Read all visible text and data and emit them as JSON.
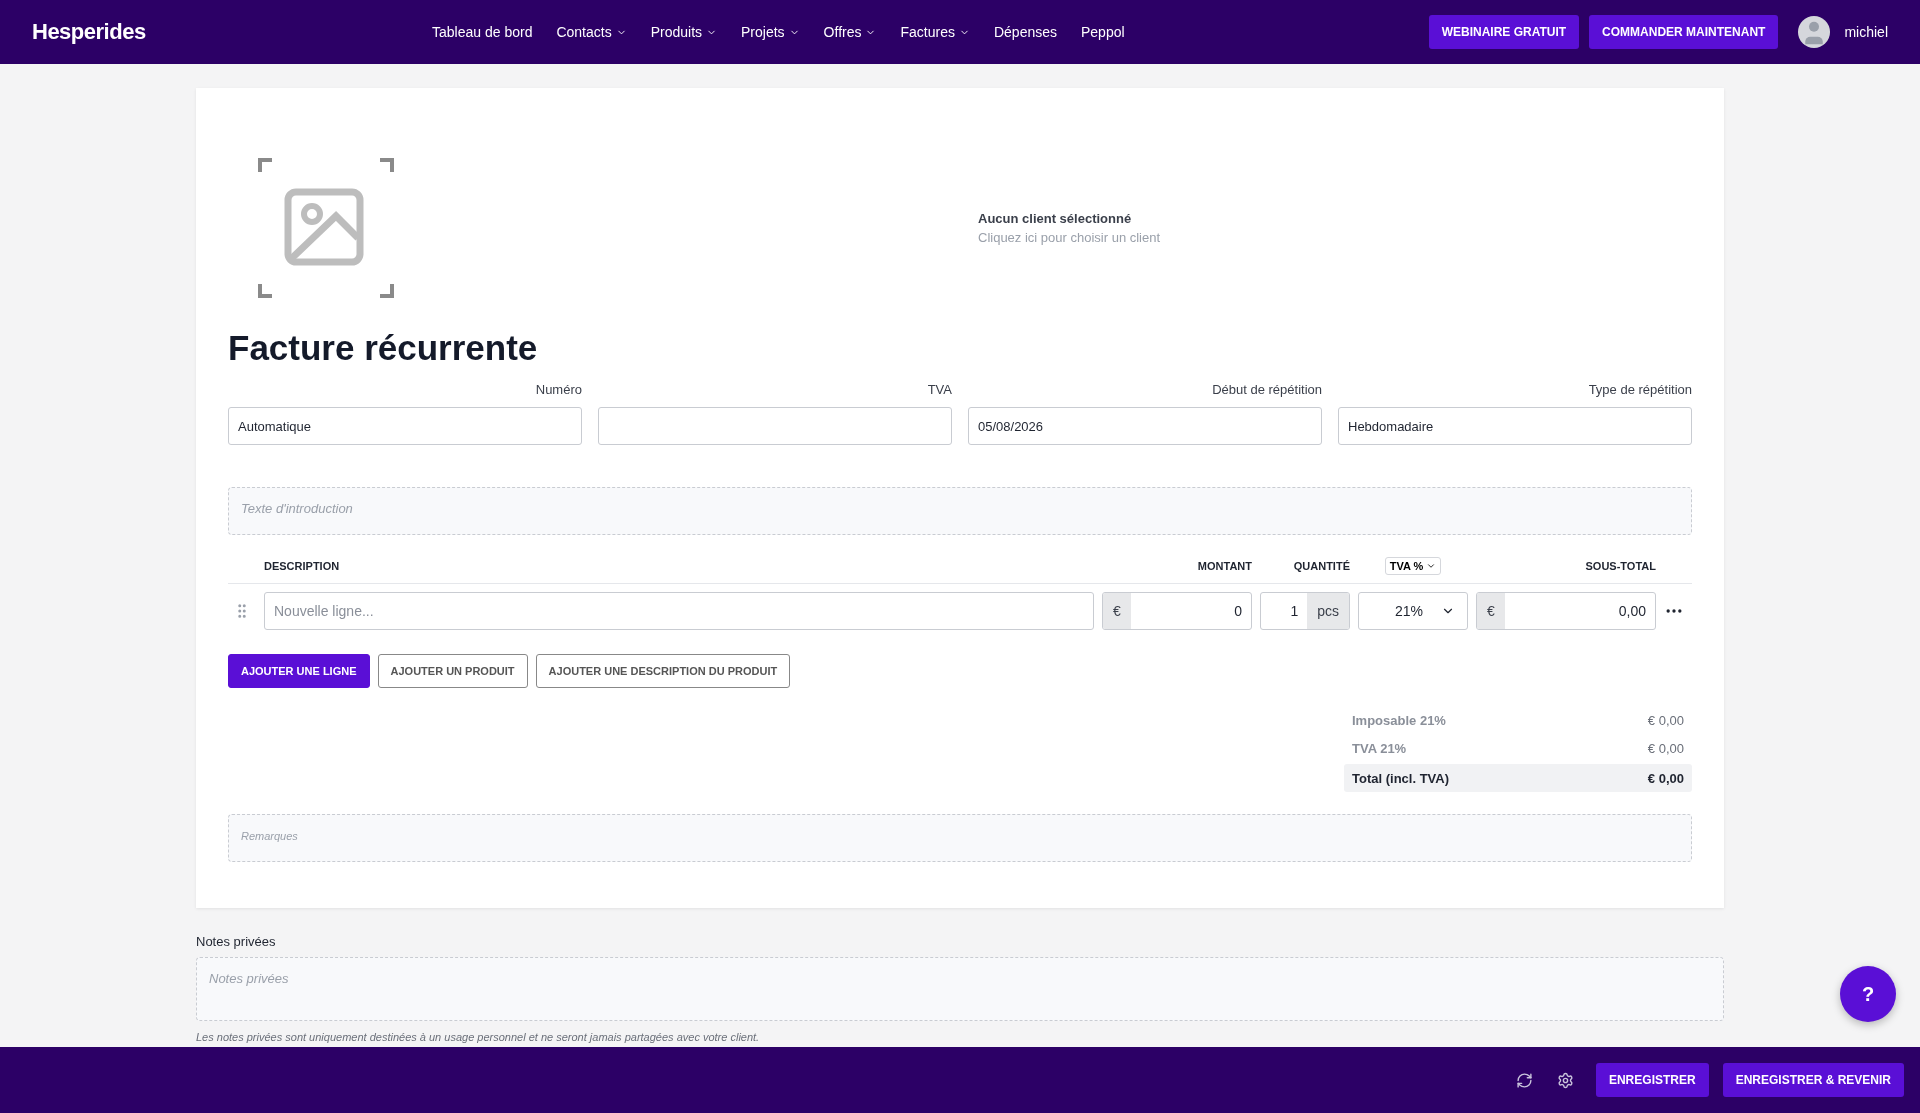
{
  "nav": {
    "logo": "Hesperides",
    "items": [
      {
        "label": "Tableau de bord",
        "dropdown": false
      },
      {
        "label": "Contacts",
        "dropdown": true
      },
      {
        "label": "Produits",
        "dropdown": true
      },
      {
        "label": "Projets",
        "dropdown": true
      },
      {
        "label": "Offres",
        "dropdown": true
      },
      {
        "label": "Factures",
        "dropdown": true
      },
      {
        "label": "Dépenses",
        "dropdown": false
      },
      {
        "label": "Peppol",
        "dropdown": false
      }
    ],
    "buttons": [
      "WEBINAIRE GRATUIT",
      "COMMANDER MAINTENANT"
    ],
    "user": "michiel"
  },
  "client": {
    "title": "Aucun client sélectionné",
    "hint": "Cliquez ici pour choisir un client"
  },
  "title": "Facture récurrente",
  "fields": [
    {
      "label": "Numéro",
      "value": "Automatique"
    },
    {
      "label": "TVA"
    },
    {
      "label": "Début de répétition",
      "value": "05/08/2026"
    },
    {
      "label": "Type de répétition",
      "value": "Hebdomadaire"
    }
  ],
  "intro": {
    "placeholder": "Texte d'introduction"
  },
  "lines": {
    "columns": [
      "DESCRIPTION",
      "MONTANT",
      "QUANTITÉ",
      "TVA %",
      "SOUS-TOTAL"
    ],
    "rows": [
      {
        "description_placeholder": "Nouvelle ligne...",
        "currency": "€",
        "amount": "0",
        "quantity": "1",
        "unit": "pcs",
        "vat": "21%",
        "subtotal_currency": "€",
        "subtotal": "0,00"
      }
    ]
  },
  "actions": [
    {
      "label": "AJOUTER UNE LIGNE",
      "kind": "primary"
    },
    {
      "label": "AJOUTER UN PRODUIT",
      "kind": "outline"
    },
    {
      "label": "AJOUTER UNE DESCRIPTION DU PRODUIT",
      "kind": "outline"
    }
  ],
  "totals": [
    {
      "label": "Imposable 21%",
      "value": "€ 0,00",
      "kind": "sub"
    },
    {
      "label": "TVA 21%",
      "value": "€ 0,00",
      "kind": "sub"
    },
    {
      "label": "Total (incl. TVA)",
      "value": "€ 0,00",
      "kind": "total"
    }
  ],
  "remarks": {
    "placeholder": "Remarques"
  },
  "private_notes": {
    "label": "Notes privées",
    "placeholder": "Notes privées",
    "hint": "Les notes privées sont uniquement destinées à un usage personnel et ne seront jamais partagées avec votre client."
  },
  "help": "?",
  "footer": {
    "buttons": [
      "ENREGISTRER",
      "ENREGISTRER & REVENIR"
    ]
  }
}
